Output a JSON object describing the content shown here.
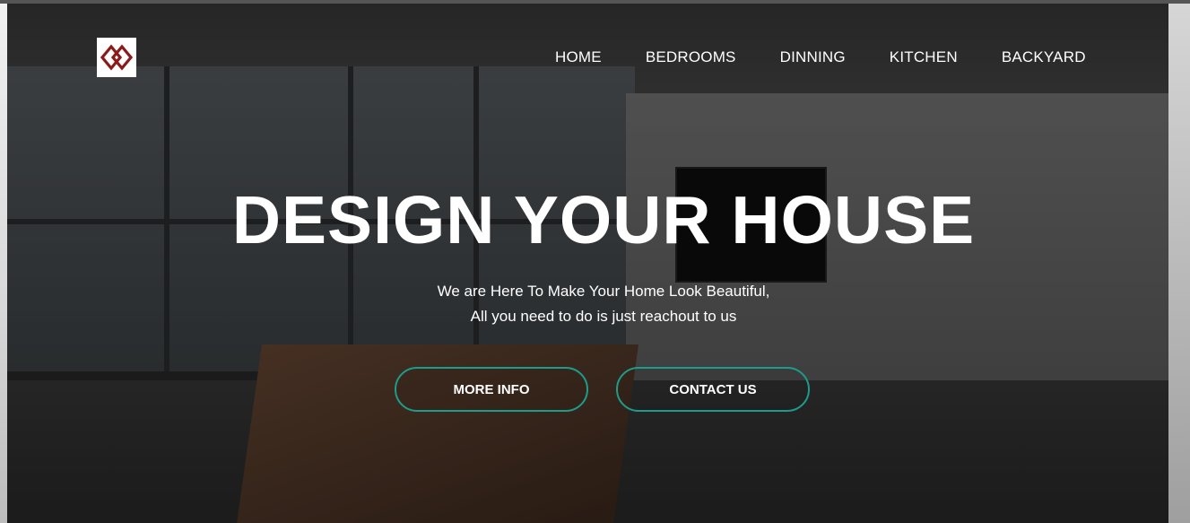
{
  "brand": {
    "logo_icon": "diamond-link-logo-icon",
    "logo_color": "#8b1a1a"
  },
  "nav": {
    "items": [
      {
        "label": "HOME"
      },
      {
        "label": "BEDROOMS"
      },
      {
        "label": "DINNING"
      },
      {
        "label": "KITCHEN"
      },
      {
        "label": "BACKYARD"
      }
    ]
  },
  "hero": {
    "headline": "DESIGN YOUR HOUSE",
    "subtitle_line1": "We are Here To Make Your Home Look Beautiful,",
    "subtitle_line2": "All you need to do is just reachout to us",
    "buttons": {
      "more_info": "MORE INFO",
      "contact_us": "CONTACT US"
    },
    "accent_color": "#1d9c8c"
  }
}
